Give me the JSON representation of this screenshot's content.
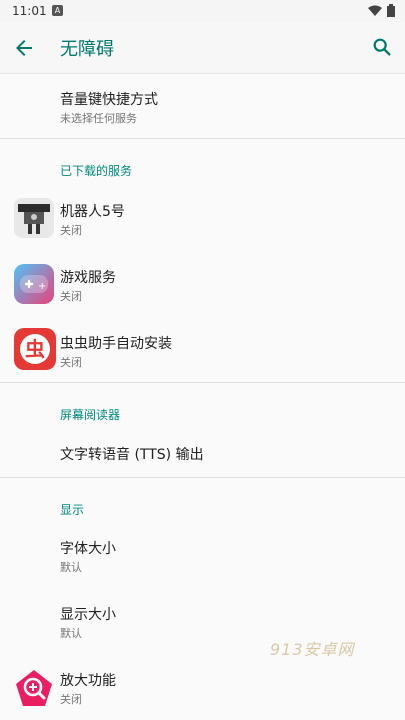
{
  "status_bar": {
    "time": "11:01",
    "notification_icon": "A"
  },
  "header": {
    "title": "无障碍"
  },
  "shortcut": {
    "title": "音量键快捷方式",
    "subtitle": "未选择任何服务"
  },
  "sections": {
    "downloaded": "已下载的服务",
    "screen_reader": "屏幕阅读器",
    "display": "显示"
  },
  "downloaded_services": [
    {
      "title": "机器人5号",
      "subtitle": "关闭",
      "icon": "robot-app-icon"
    },
    {
      "title": "游戏服务",
      "subtitle": "关闭",
      "icon": "game-controller-app-icon"
    },
    {
      "title": "虫虫助手自动安装",
      "subtitle": "关闭",
      "icon": "chongchong-app-icon",
      "icon_text": "虫"
    }
  ],
  "tts": {
    "title": "文字转语音 (TTS) 输出"
  },
  "display_items": [
    {
      "title": "字体大小",
      "subtitle": "默认"
    },
    {
      "title": "显示大小",
      "subtitle": "默认"
    },
    {
      "title": "放大功能",
      "subtitle": "关闭",
      "icon": "magnifier-app-icon"
    }
  ],
  "watermark": "913安卓网",
  "colors": {
    "accent": "#00796b",
    "section": "#00897b",
    "chongchong_red": "#e53935",
    "magnifier_pink": "#e91e63"
  }
}
